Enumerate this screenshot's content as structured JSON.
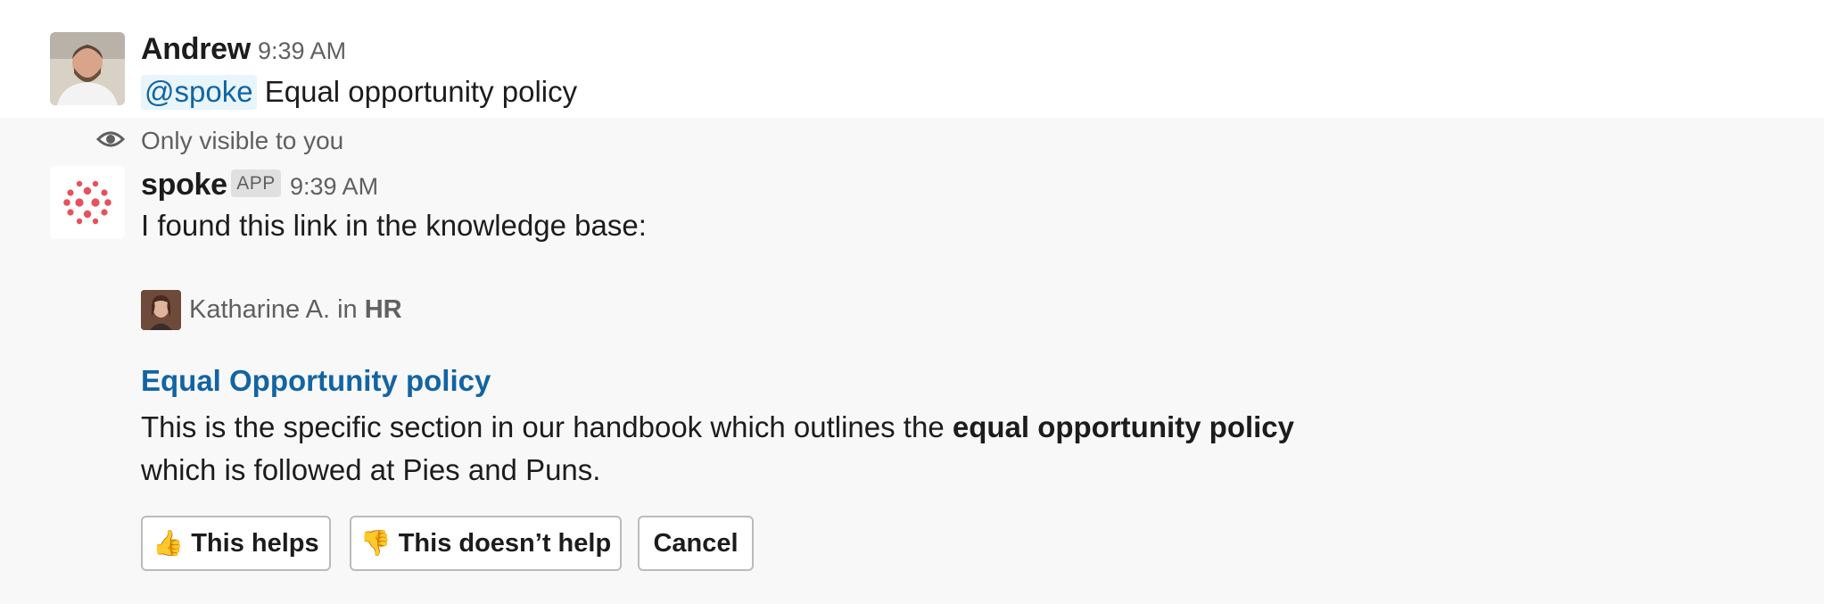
{
  "message_user": {
    "name": "Andrew",
    "time": "9:39 AM",
    "mention": "@spoke",
    "text": "Equal opportunity policy"
  },
  "message_bot": {
    "visibility_note": "Only visible to you",
    "name": "spoke",
    "badge": "APP",
    "time": "9:39 AM",
    "intro": "I found this link in the knowledge base:",
    "author": {
      "name": "Katharine A.",
      "in_word": "in",
      "channel": "HR"
    },
    "link_title": "Equal Opportunity policy",
    "description": {
      "part1": "This is the specific section in our handbook which outlines the ",
      "bold": "equal opportunity policy",
      "line2": "which is followed at Pies and Puns."
    },
    "buttons": {
      "helps": {
        "emoji": "👍",
        "label": "This helps"
      },
      "no_help": {
        "emoji": "👎",
        "label": "This doesn’t help"
      },
      "cancel": {
        "label": "Cancel"
      }
    }
  },
  "colors": {
    "link": "#1264a3",
    "mention_bg": "#e8f5fa",
    "spoke_logo": "#e8505b",
    "bot_message_bg": "#f8f8f8"
  },
  "icons": {
    "visibility": "eye-icon",
    "spoke_logo": "spoke-logo-icon"
  }
}
